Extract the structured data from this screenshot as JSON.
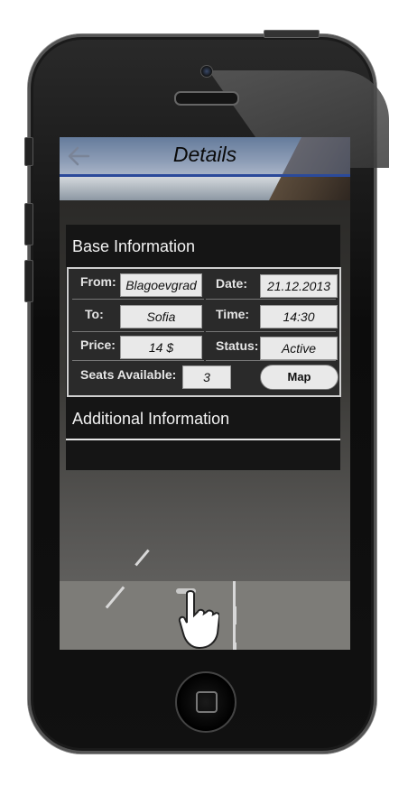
{
  "header": {
    "title": "Details",
    "back_icon": "arrow-left-icon"
  },
  "base_info": {
    "title": "Base Information",
    "from_label": "From:",
    "from_value": "Blagoevgrad",
    "to_label": "To:",
    "to_value": "Sofia",
    "price_label": "Price:",
    "price_value": "14 $",
    "seats_label": "Seats Available:",
    "seats_value": "3",
    "date_label": "Date:",
    "date_value": "21.12.2013",
    "time_label": "Time:",
    "time_value": "14:30",
    "status_label": "Status:",
    "status_value": "Active",
    "map_button": "Map"
  },
  "additional_info": {
    "title": "Additional Information"
  },
  "colors": {
    "header_accent": "#2b4a9a",
    "panel": "#151515",
    "field": "#e9e9e9"
  },
  "icons": {
    "gesture": "tap-hand-icon",
    "home": "home-button-icon"
  }
}
